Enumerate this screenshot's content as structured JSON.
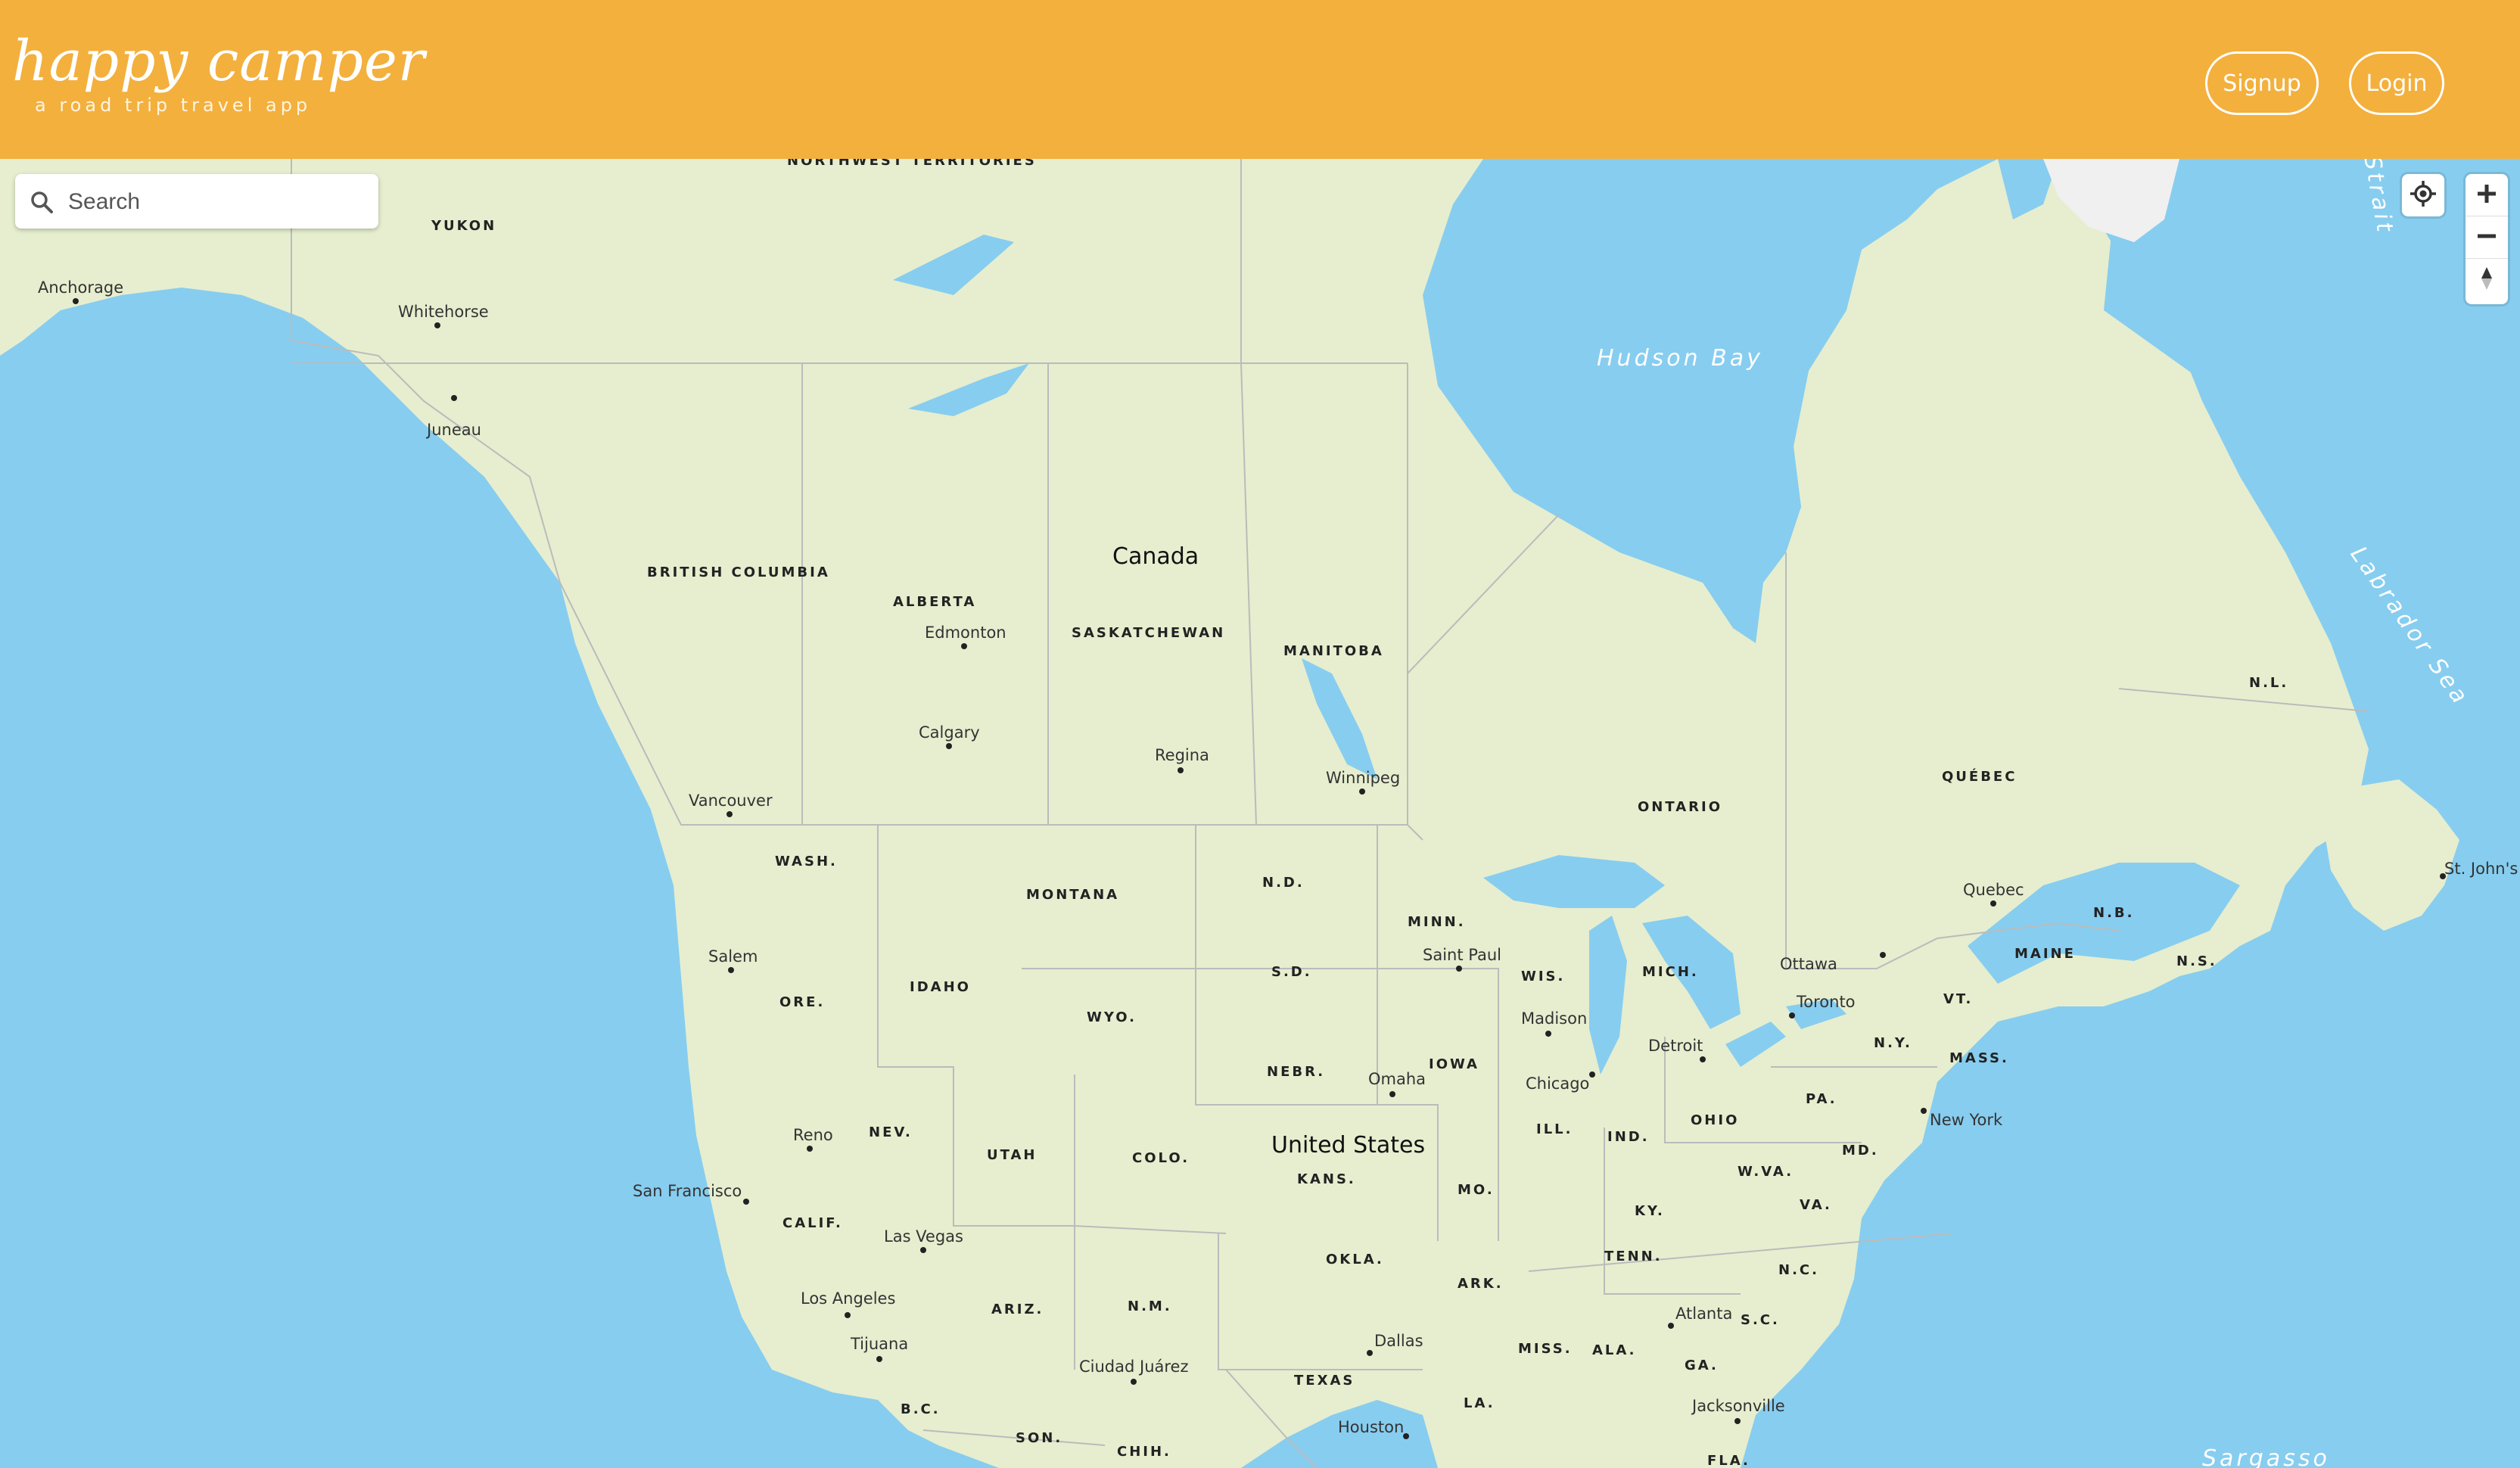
{
  "header": {
    "logo_title": "happy camper",
    "logo_tagline": "a road trip travel app",
    "signup_label": "Signup",
    "login_label": "Login"
  },
  "search": {
    "placeholder": "Search"
  },
  "controls": {
    "geolocate_icon": "geolocate-icon",
    "zoom_in_icon": "plus-icon",
    "zoom_out_icon": "minus-icon",
    "compass_icon": "compass-icon"
  },
  "colors": {
    "header": "#f3b03d",
    "water": "#87cdef",
    "land": "#e6eecf"
  },
  "map": {
    "countries": {
      "canada": "Canada",
      "usa": "United States"
    },
    "water": {
      "hudson": "Hudson Bay",
      "labrador": "Labrador Sea",
      "strait": "Strait",
      "sargasso": "Sargasso"
    },
    "regions": {
      "nwt": "NORTHWEST TERRITORIES",
      "yukon": "YUKON",
      "bc": "BRITISH COLUMBIA",
      "alberta": "ALBERTA",
      "saskatchewan": "SASKATCHEWAN",
      "manitoba": "MANITOBA",
      "ontario": "ONTARIO",
      "quebec": "QUÉBEC",
      "nl": "N.L.",
      "nb": "N.B.",
      "ns": "N.S.",
      "maine": "MAINE",
      "vt": "VT.",
      "mass": "MASS.",
      "ny": "N.Y.",
      "pa": "PA.",
      "md": "MD.",
      "wva": "W.VA.",
      "va": "VA.",
      "nc": "N.C.",
      "sc": "S.C.",
      "ga": "GA.",
      "fla": "FLA.",
      "ala": "ALA.",
      "miss": "MISS.",
      "la": "LA.",
      "tenn": "TENN.",
      "ky": "KY.",
      "ohio": "OHIO",
      "ind": "IND.",
      "ill": "ILL.",
      "mich": "MICH.",
      "wis": "WIS.",
      "minn": "MINN.",
      "iowa": "IOWA",
      "mo": "MO.",
      "ark": "ARK.",
      "texas": "TEXAS",
      "okla": "OKLA.",
      "kans": "KANS.",
      "nebr": "NEBR.",
      "sd": "S.D.",
      "nd": "N.D.",
      "montana": "MONTANA",
      "wyo": "WYO.",
      "colo": "COLO.",
      "nm": "N.M.",
      "ariz": "ARIZ.",
      "utah": "UTAH",
      "nev": "NEV.",
      "idaho": "IDAHO",
      "ore": "ORE.",
      "wash": "WASH.",
      "calif": "CALIF.",
      "bc_mx": "B.C.",
      "son": "SON.",
      "chih": "CHIH."
    },
    "cities": {
      "anchorage": "Anchorage",
      "whitehorse": "Whitehorse",
      "juneau": "Juneau",
      "edmonton": "Edmonton",
      "calgary": "Calgary",
      "regina": "Regina",
      "winnipeg": "Winnipeg",
      "vancouver": "Vancouver",
      "salem": "Salem",
      "reno": "Reno",
      "sanfrancisco": "San Francisco",
      "lasvegas": "Las Vegas",
      "losangeles": "Los Angeles",
      "tijuana": "Tijuana",
      "ciudadjuarez": "Ciudad Juárez",
      "dallas": "Dallas",
      "houston": "Houston",
      "omaha": "Omaha",
      "saintpaul": "Saint Paul",
      "madison": "Madison",
      "chicago": "Chicago",
      "detroit": "Detroit",
      "toronto": "Toronto",
      "ottawa": "Ottawa",
      "quebec_city": "Quebec",
      "stjohns": "St. John's",
      "newyork": "New York",
      "atlanta": "Atlanta",
      "jacksonville": "Jacksonville"
    }
  }
}
